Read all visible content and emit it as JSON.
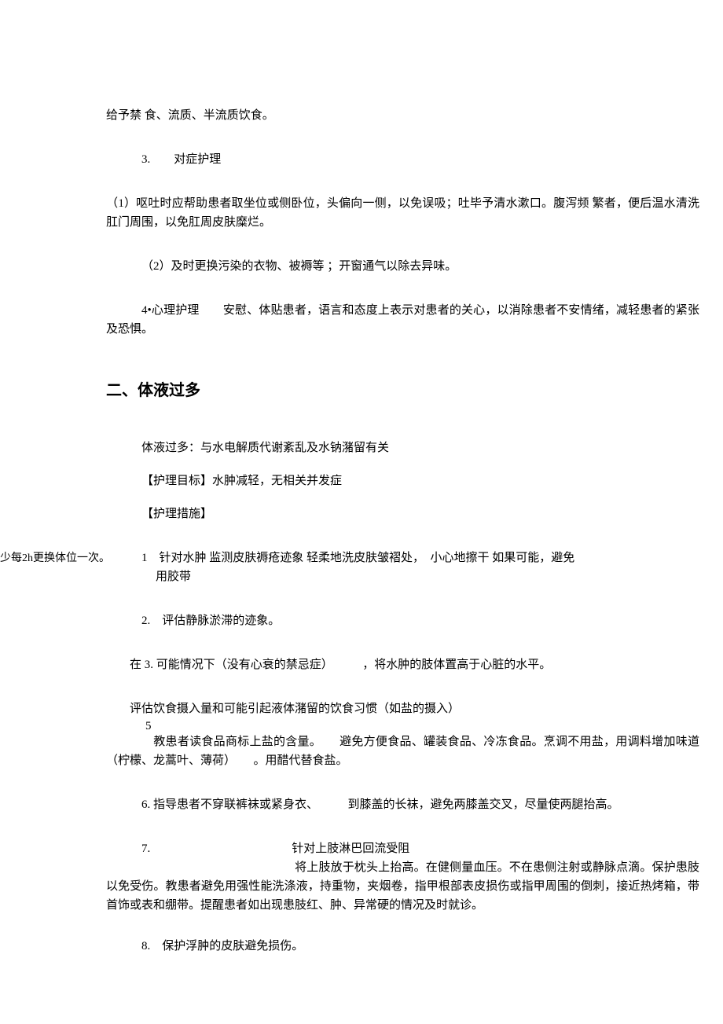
{
  "top": {
    "p0": "给予禁 食、流质、半流质饮食。",
    "p1_num": "3.",
    "p1_label": "对症护理",
    "p2": "（1）呕吐时应帮助患者取坐位或侧卧位，头偏向一侧，以免误吸；吐毕予清水漱口。腹泻频 繁者，便后温水清洗肛门周围，以免肛周皮肤糜烂。",
    "p3": "（2）及时更换污染的衣物、被褥等 ；开窗通气以除去异味。",
    "p4_num": "4•",
    "p4_label": "心理护理",
    "p4_text": "安慰、体贴患者，语言和态度上表示对患者的关心，以消除患者不安情绪，减轻患者的紧张及恐惧。"
  },
  "section2": {
    "title": "二、体液过多",
    "p1": "体液过多：与水电解质代谢紊乱及水钠潴留有关",
    "p2": "【护理目标】水肿减轻，无相关并发症",
    "p3": "【护理措施】",
    "side": "少每2h更换体位一次。",
    "m1_line1": "1　针对水肿 监测皮肤褥疮迹象 轻柔地洗皮肤皱褶处，　小心地擦干 如果可能，避免",
    "m1_line2": "用胶带",
    "m2": "2.　评估静脉淤滞的迹象。",
    "m3": "在 3. 可能情况下（没有心衰的禁忌症）　　　，将水肿的肢体置高于心脏的水平。",
    "m4": "评估饮食摄入量和可能引起液体潴留的饮食习惯（如盐的摄入）",
    "m5_num": "5",
    "m5": "教患者读食品商标上盐的含量。　　避免方便食品、罐装食品、冷冻食品。烹调不用盐，用调料增加味道（柠檬、龙蒿叶、薄荷）　　。用醋代替食盐。",
    "m6": "6. 指导患者不穿联裤袜或紧身衣、　　　到膝盖的长袜，避免两膝盖交叉，尽量使两腿抬高。",
    "m7_num": "7.",
    "m7_title": "针对上肢淋巴回流受阻",
    "m7_body": "将上肢放于枕头上抬高。在健侧量血压。不在患侧注射或静脉点滴。保护患肢以免受伤。教患者避免用强性能洗涤液，持重物，夹烟卷，指甲根部表皮损伤或指甲周围的倒刺，接近热烤箱，带首饰或表和绷带。提醒患者如出现患肢红、肿、异常硬的情况及时就诊。",
    "m8": "8.　保护浮肿的皮肤避免损伤。"
  }
}
